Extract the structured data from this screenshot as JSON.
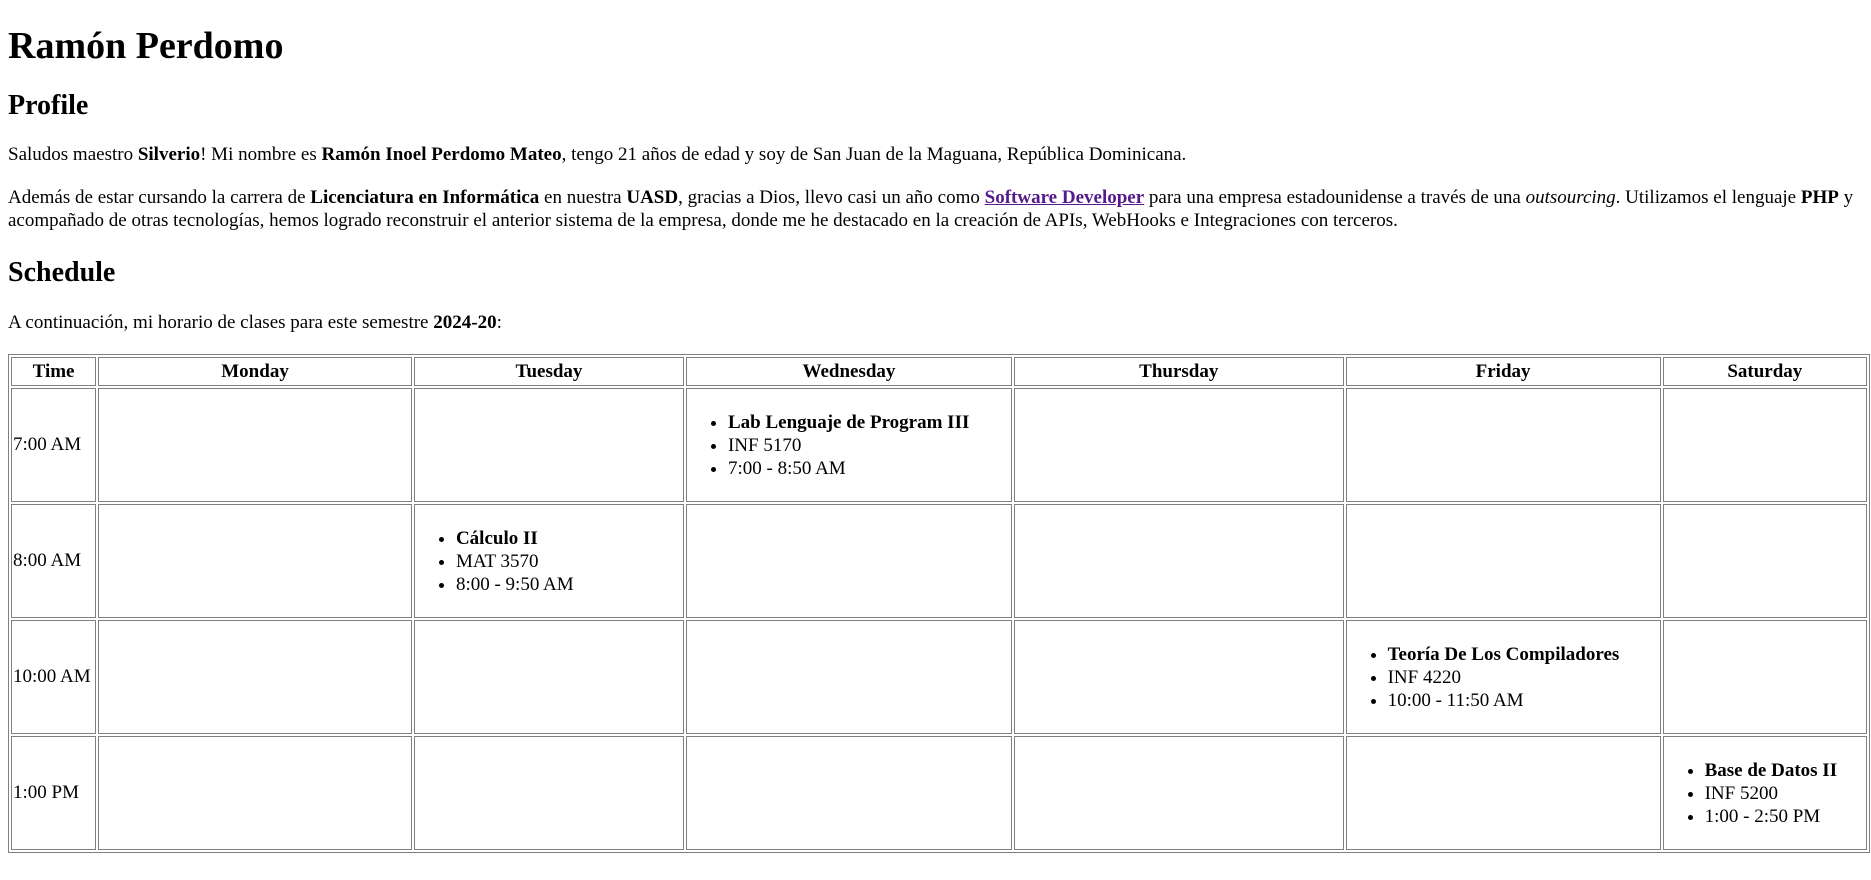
{
  "title": "Ramón Perdomo",
  "profile": {
    "heading": "Profile",
    "intro": {
      "t1": "Saludos maestro ",
      "teacher": "Silverio",
      "t2": "! Mi nombre es ",
      "full_name": "Ramón Inoel Perdomo Mateo",
      "t3": ", tengo 21 años de edad y soy de San Juan de la Maguana, República Dominicana."
    },
    "para2": {
      "t1": "Además de estar cursando la carrera de ",
      "degree": "Licenciatura en Informática",
      "t2": " en nuestra ",
      "university": "UASD",
      "t3": ", gracias a Dios, llevo casi un año como ",
      "role_link": "Software Developer",
      "t4": " para una empresa estadounidense a través de una ",
      "outsourcing": "outsourcing",
      "t5": ". Utilizamos el lenguaje ",
      "language": "PHP",
      "t6": " y acompañado de otras tecnologías, hemos logrado reconstruir el anterior sistema de la empresa, donde me he destacado en la creación de APIs, WebHooks e Integraciones con terceros."
    }
  },
  "schedule": {
    "heading": "Schedule",
    "intro": {
      "t1": "A continuación, mi horario de clases para este semestre ",
      "semester": "2024-20",
      "t2": ":"
    },
    "headers": [
      "Time",
      "Monday",
      "Tuesday",
      "Wednesday",
      "Thursday",
      "Friday",
      "Saturday"
    ],
    "rows": [
      {
        "time": "7:00 AM",
        "wednesday": {
          "name": "Lab Lenguaje de Program III",
          "code": "INF 5170",
          "hours": "7:00 - 8:50 AM"
        }
      },
      {
        "time": "8:00 AM",
        "tuesday": {
          "name": "Cálculo II",
          "code": "MAT 3570",
          "hours": "8:00 - 9:50 AM"
        }
      },
      {
        "time": "10:00 AM",
        "friday": {
          "name": "Teoría De Los Compiladores",
          "code": "INF 4220",
          "hours": "10:00 - 11:50 AM"
        }
      },
      {
        "time": "1:00 PM",
        "saturday": {
          "name": "Base de Datos II",
          "code": "INF 5200",
          "hours": "1:00 - 2:50 PM"
        }
      }
    ]
  }
}
